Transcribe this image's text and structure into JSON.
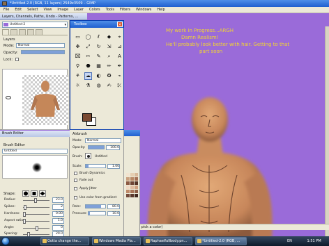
{
  "main_window": {
    "title": "*Untitled-2.0 (RGB, 11 layers) 2549x3509 – GIMP",
    "menu": [
      "File",
      "Edit",
      "Select",
      "View",
      "Image",
      "Layer",
      "Colors",
      "Tools",
      "Filters",
      "Windows",
      "Help"
    ],
    "canvas_text": [
      "My work in Progress...ARGH",
      "Damn Realism!",
      "He'll probably look better with hair. Getting to that",
      "part soon"
    ],
    "status_text": "o pick a color)"
  },
  "layers_dock": {
    "title": "Layers, Channels, Paths, Undo - Patterns, ...",
    "image_selector": "Untitled-2",
    "section_label": "Layers",
    "mode_label": "Mode:",
    "mode_value": "Normal",
    "opacity_label": "Opacity:",
    "lock_label": "Lock:"
  },
  "toolbox": {
    "title": "Toolbox",
    "tools": [
      "▭",
      "◯",
      "ℓ",
      "◆",
      "⌖",
      "✥",
      "⤢",
      "↻",
      "⇲",
      "⊿",
      "⌧",
      "✂",
      "✎",
      "⌕",
      "A",
      "⚲",
      "⬣",
      "▦",
      "✏",
      "✒",
      "⚘",
      "☁",
      "◐",
      "✪",
      "⌁",
      "☼",
      "⚗",
      "◍",
      "✍",
      "⤪"
    ]
  },
  "tool_options": {
    "title": "Airbrush",
    "mode_label": "Mode:",
    "mode_value": "Normal",
    "opacity_label": "Opacity:",
    "opacity_value": "100.0",
    "brush_label": "Brush:",
    "brush_value": "Untitled",
    "scale_label": "Scale:",
    "scale_value": "1.00",
    "brush_dynamics_label": "Brush Dynamics",
    "fade_out_label": "Fade out",
    "apply_jitter_label": "Apply Jitter",
    "use_color_gradient_label": "Use color from gradient",
    "rate_label": "Rate:",
    "rate_value": "80.0",
    "pressure_label": "Pressure:",
    "pressure_value": "10.0"
  },
  "brush_editor": {
    "title": "Brush Editor",
    "header": "Brush Editor",
    "brush_name": "Untitled",
    "shape_label": "Shape:",
    "radius_label": "Radius:",
    "radius_value": "23.0",
    "spikes_label": "Spikes:",
    "spikes_value": "2",
    "hardness_label": "Hardness:",
    "hardness_value": "0.00",
    "aspect_label": "Aspect ratio:",
    "aspect_value": "1.0",
    "angle_label": "Angle:",
    "angle_value": "0",
    "spacing_label": "Spacing:",
    "spacing_value": "20.0"
  },
  "palette_colors": [
    "#f2e3cf",
    "#e6cfb2",
    "#d9b99a",
    "#c9a07e",
    "#b88866",
    "#a47055",
    "#8c5a44",
    "#6f4535",
    "#553326",
    "#f0d8c4",
    "#e0bca0",
    "#d0a07f",
    "#bf8a68",
    "#a87458",
    "#8e5f48",
    "#734a3a",
    "#5a382c",
    "#40271f"
  ],
  "taskbar": {
    "items": [
      {
        "label": "Gotta change the...",
        "active": false
      },
      {
        "label": "Windows Media Pla...",
        "active": false
      },
      {
        "label": "Raphaelfullbody.pn...",
        "active": false
      },
      {
        "label": "*Untitled-2.0 (RGB, ...",
        "active": true
      }
    ],
    "language": "EN",
    "clock": "1:51 PM"
  }
}
